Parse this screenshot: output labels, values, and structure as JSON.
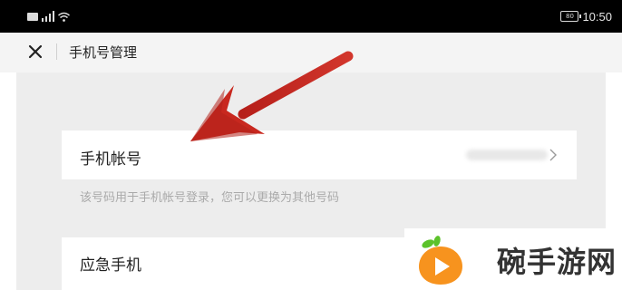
{
  "status_bar": {
    "time": "10:50",
    "battery_level": "80"
  },
  "nav": {
    "title": "手机号管理"
  },
  "settings": {
    "phone_account_label": "手机帐号",
    "phone_account_value": "",
    "phone_hint": "该号码用于手机帐号登录，您可以更换为其他号码",
    "emergency_phone_label": "应急手机"
  },
  "watermark": {
    "text": "碗手游网"
  },
  "colors": {
    "arrow": "#c8281f",
    "content_background": "#ededed",
    "watermark_orange": "#f7931e",
    "watermark_green": "#5cc22a"
  }
}
